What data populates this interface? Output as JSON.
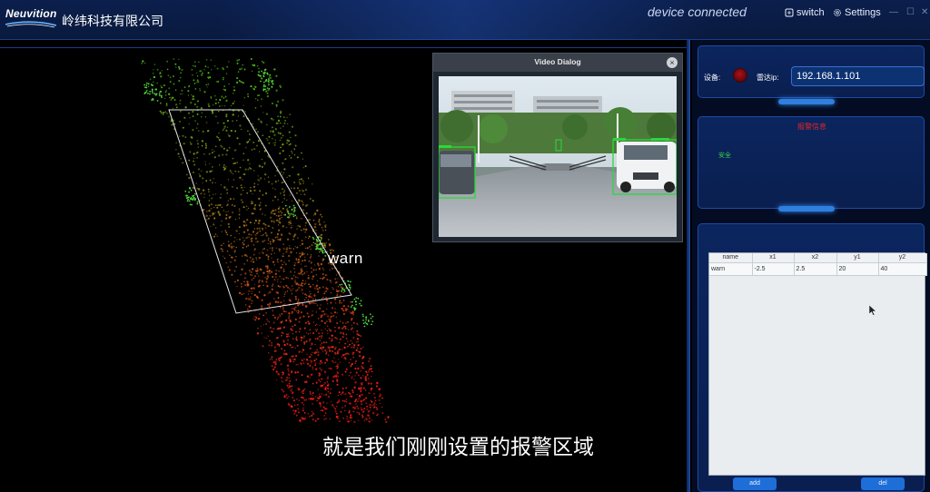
{
  "titlebar": {
    "logo_text": "Neuvition",
    "company_name": "岭纬科技有限公司",
    "status": "device connected",
    "switch_label": "switch",
    "settings_label": "Settings"
  },
  "viewport": {
    "zone_label": "warn",
    "subtitle": "就是我们刚刚设置的报警区域"
  },
  "video_dialog": {
    "title": "Video Dialog"
  },
  "device_panel": {
    "device_label": "设备:",
    "radar_ip_label": "雷达ip:",
    "radar_ip_value": "192.168.1.101"
  },
  "alarm_panel": {
    "title": "报警信息",
    "status_text": "安全"
  },
  "zones_table": {
    "columns": [
      "name",
      "x1",
      "x2",
      "y1",
      "y2"
    ],
    "rows": [
      [
        "warn",
        "-2.5",
        "2.5",
        "20",
        "40"
      ]
    ],
    "add_label": "add",
    "del_label": "del"
  },
  "colors": {
    "title_bg": "#0a1a3e",
    "accent_blue": "#1e6ed8",
    "alarm_red": "#e0262a",
    "safe_green": "#3fcf4a"
  }
}
